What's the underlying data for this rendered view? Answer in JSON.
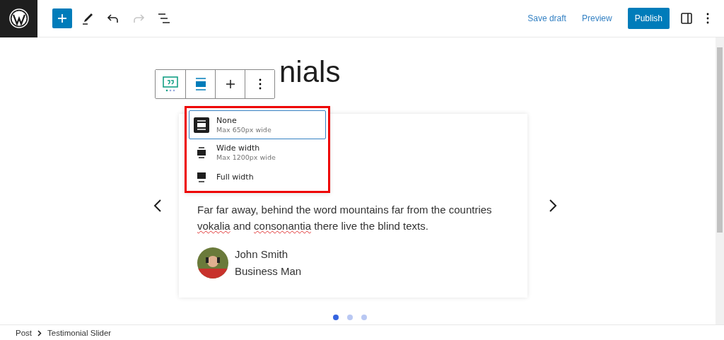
{
  "topbar": {
    "tools": [
      {
        "kind": "add",
        "disabled": false
      },
      {
        "kind": "pen",
        "disabled": false
      },
      {
        "kind": "undo",
        "disabled": false
      },
      {
        "kind": "redo",
        "disabled": true
      },
      {
        "kind": "outline",
        "disabled": false
      }
    ],
    "links": [
      "Save draft",
      "Preview"
    ],
    "publish": "Publish"
  },
  "heading": "nials",
  "block_toolbar": [
    {
      "kind": "quote"
    },
    {
      "kind": "align"
    },
    {
      "kind": "plus"
    },
    {
      "kind": "more"
    }
  ],
  "align_menu": [
    {
      "kind": "none",
      "label": "None",
      "hint": "Max 650px wide",
      "selected": true
    },
    {
      "kind": "wide",
      "label": "Wide width",
      "hint": "Max 1200px wide",
      "selected": false
    },
    {
      "kind": "full",
      "label": "Full width",
      "selected": false
    }
  ],
  "testimonial": {
    "text": [
      {
        "text": "Far far away, behind the word mountains far from the countries ",
        "misspelled": false
      },
      {
        "text": "vokalia",
        "misspelled": true
      },
      {
        "text": " and ",
        "misspelled": false
      },
      {
        "text": "consonantia",
        "misspelled": true
      },
      {
        "text": " there live the blind texts.",
        "misspelled": false
      }
    ],
    "name": "John Smith",
    "role": "Business Man"
  },
  "dots": [
    {
      "selected": true
    },
    {
      "selected": false
    },
    {
      "selected": false
    }
  ],
  "breadcrumb": [
    "Post",
    "Testimonial Slider"
  ]
}
